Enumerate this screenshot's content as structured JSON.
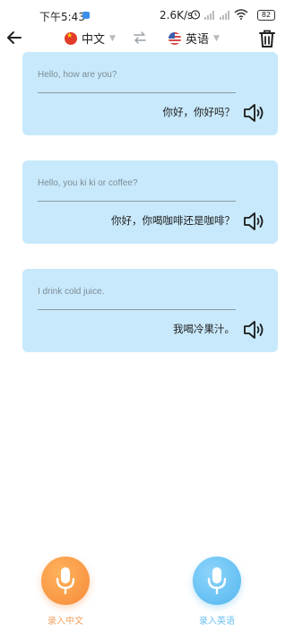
{
  "status_bar": {
    "time": "下午5:43",
    "net_speed": "2.6K/s",
    "battery": "82"
  },
  "topbar": {
    "source_language": "中文",
    "target_language": "英语"
  },
  "cards": [
    {
      "source": "Hello, how are you?",
      "translation": "你好，你好吗？"
    },
    {
      "source": "Hello, you ki ki or coffee?",
      "translation": "你好，你喝咖啡还是咖啡？"
    },
    {
      "source": "I drink cold juice.",
      "translation": "我喝冷果汁。"
    }
  ],
  "bottom": {
    "record_chinese_label": "录入中文",
    "record_english_label": "录入英语"
  },
  "colors": {
    "card_background": "#c8e9fb",
    "mic_chinese": "#f58a3a",
    "mic_english": "#52b6ee"
  }
}
